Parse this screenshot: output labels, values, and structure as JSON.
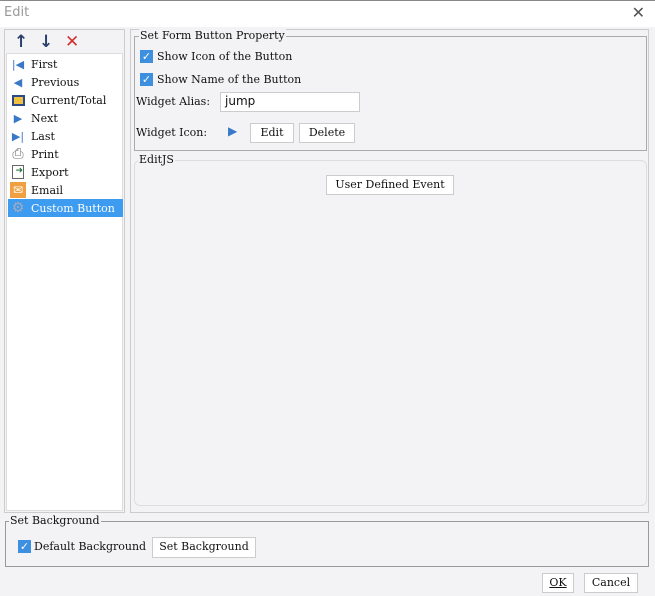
{
  "window": {
    "title": "Edit",
    "close_icon": "close-icon"
  },
  "toolbar": {
    "up": "↑",
    "down": "↓",
    "delete": "✕"
  },
  "list": {
    "items": [
      {
        "label": "First",
        "icon": "first-icon"
      },
      {
        "label": "Previous",
        "icon": "previous-icon"
      },
      {
        "label": "Current/Total",
        "icon": "current-total-icon"
      },
      {
        "label": "Next",
        "icon": "next-icon"
      },
      {
        "label": "Last",
        "icon": "last-icon"
      },
      {
        "label": "Print",
        "icon": "print-icon"
      },
      {
        "label": "Export",
        "icon": "export-icon"
      },
      {
        "label": "Email",
        "icon": "email-icon"
      },
      {
        "label": "Custom Button",
        "icon": "gear-icon",
        "selected": true
      }
    ]
  },
  "property": {
    "title": "Set Form Button Property",
    "show_icon": "Show Icon of the Button",
    "show_name": "Show Name of the Button",
    "alias_label": "Widget Alias:",
    "alias_value": "jump",
    "icon_label": "Widget Icon:",
    "edit": "Edit",
    "delete": "Delete"
  },
  "editjs": {
    "title": "EditJS",
    "event_button": "User Defined Event"
  },
  "background": {
    "title": "Set Background",
    "default_label": "Default Background",
    "set_button": "Set Background"
  },
  "footer": {
    "ok": "OK",
    "cancel": "Cancel"
  },
  "colors": {
    "accent": "#3d9cf0",
    "arrow": "#3a5a9a",
    "icon_blue": "#3a78c8"
  }
}
